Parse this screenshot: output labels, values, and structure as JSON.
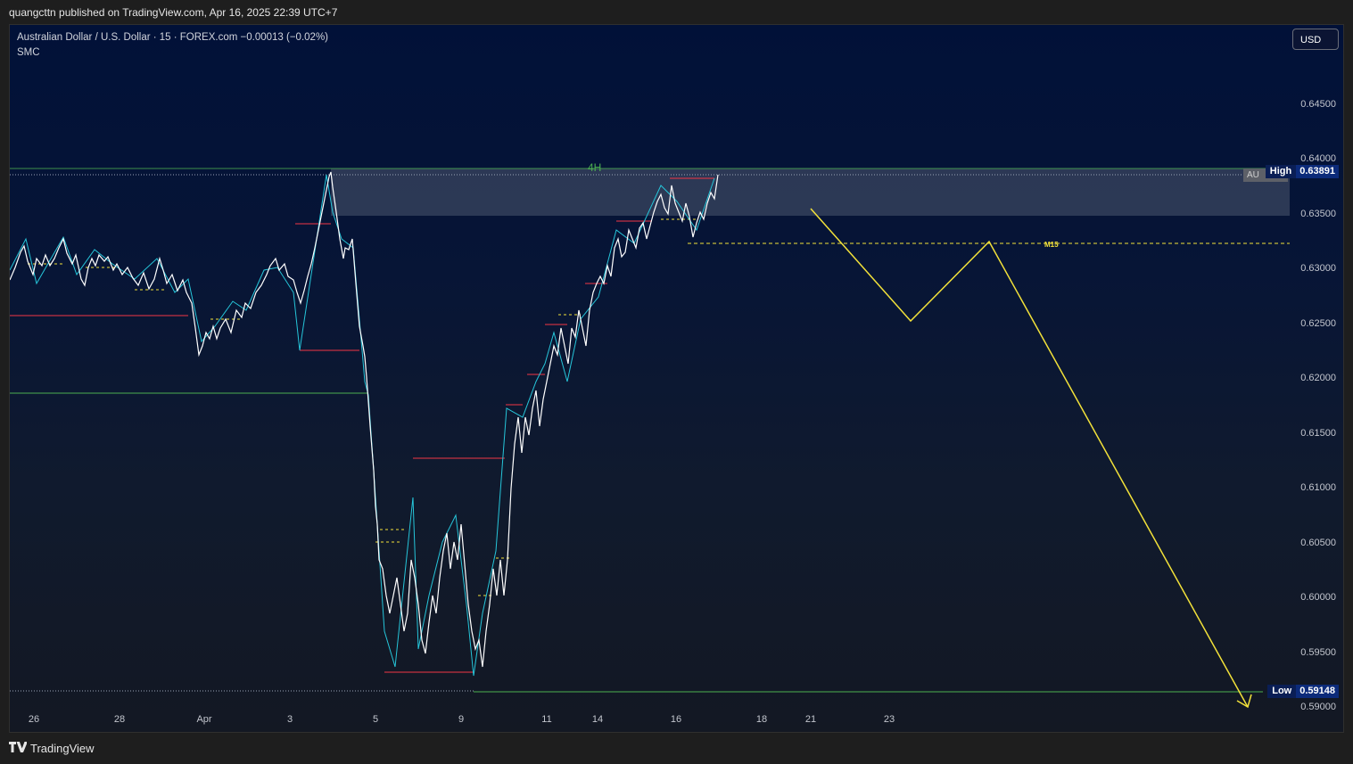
{
  "header": {
    "publish_info": "quangcttn published on TradingView.com, Apr 16, 2025 22:39 UTC+7"
  },
  "chart": {
    "symbol": "Australian Dollar / U.S. Dollar · 15 · FOREX.com",
    "change": "−0.00013 (−0.02%)",
    "indicator": "SMC",
    "currency_button": "USD",
    "zone_label": "4H",
    "level_label": "M15",
    "au_tag": "AU",
    "high_label": "High",
    "high_value": "0.63891",
    "low_label": "Low",
    "low_value": "0.59148",
    "price_axis": [
      "0.64500",
      "0.64000",
      "0.63500",
      "0.63000",
      "0.62500",
      "0.62000",
      "0.61500",
      "0.61000",
      "0.60500",
      "0.60000",
      "0.59500",
      "0.59000"
    ],
    "time_axis": [
      "26",
      "28",
      "Apr",
      "3",
      "5",
      "9",
      "11",
      "14",
      "16",
      "18",
      "21",
      "23"
    ],
    "colors": {
      "zone": "#3a4660",
      "projection": "#f2e13a",
      "high_low_line": "#4caf50",
      "structure_red": "#f23645",
      "candles": "#ffffff",
      "swing_line": "#26c6da"
    }
  },
  "footer": {
    "brand": "TradingView"
  }
}
